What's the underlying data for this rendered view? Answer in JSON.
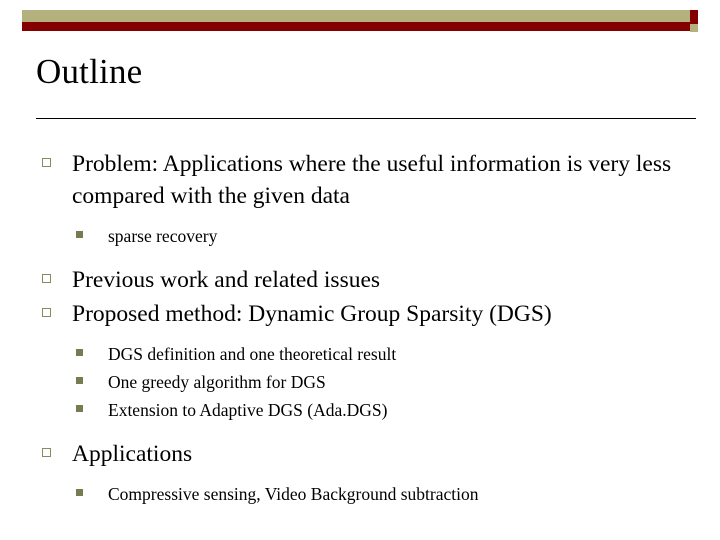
{
  "slide": {
    "title": "Outline",
    "decor": {
      "khaki": "#b3b27f",
      "maroon": "#840000"
    },
    "items": [
      {
        "level": 1,
        "text": "Problem: Applications where the useful information is very less compared with the given data"
      },
      {
        "level": 2,
        "text": "sparse recovery"
      },
      {
        "level": 1,
        "text": "Previous work and related issues"
      },
      {
        "level": 1,
        "text": "Proposed method: Dynamic Group Sparsity (DGS)"
      },
      {
        "level": 2,
        "text": "DGS definition and one theoretical result"
      },
      {
        "level": 2,
        "text": "One greedy algorithm for DGS"
      },
      {
        "level": 2,
        "text": "Extension to Adaptive DGS (Ada.DGS)"
      },
      {
        "level": 1,
        "text": "Applications"
      },
      {
        "level": 2,
        "text": "Compressive sensing, Video Background subtraction"
      }
    ]
  }
}
